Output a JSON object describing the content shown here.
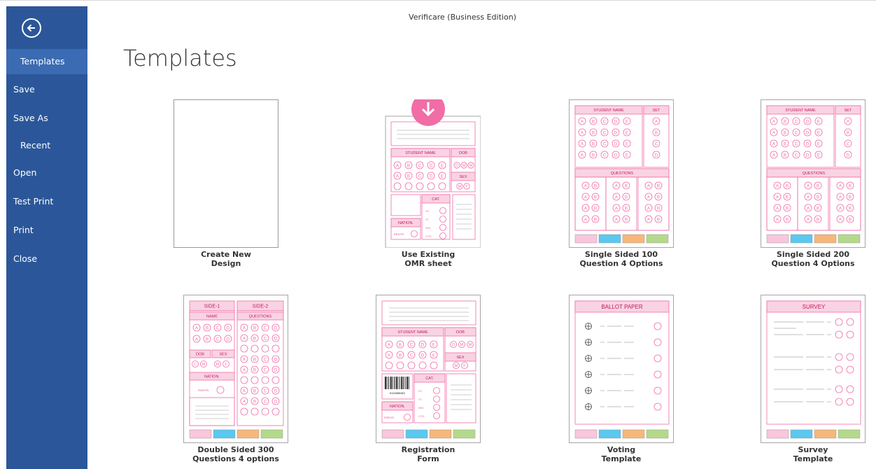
{
  "window": {
    "title": "Verificare (Business Edition)"
  },
  "sidebar": {
    "back_icon": "arrow-left-icon",
    "items": [
      {
        "label": "Templates",
        "active": true
      },
      {
        "label": "Save"
      },
      {
        "label": "Save As"
      },
      {
        "label": "Recent"
      },
      {
        "label": "Open"
      },
      {
        "label": "Test Print"
      },
      {
        "label": "Print"
      },
      {
        "label": "Close"
      }
    ]
  },
  "main": {
    "title": "Templates",
    "templates": [
      {
        "line1": "Create New",
        "line2": "Design"
      },
      {
        "line1": "Use Existing",
        "line2": "OMR sheet"
      },
      {
        "line1": "Single Sided 100",
        "line2": "Question 4 Options"
      },
      {
        "line1": "Single Sided 200",
        "line2": "Question 4 Options"
      },
      {
        "line1": "Double Sided 300",
        "line2": "Questions 4 options"
      },
      {
        "line1": "Registration",
        "line2": "Form"
      },
      {
        "line1": "Voting",
        "line2": "Template"
      },
      {
        "line1": "Survey",
        "line2": "Template"
      }
    ]
  },
  "thumbs": {
    "student_name": "STUDENT NAME",
    "set": "SET",
    "dob": "DOB",
    "sex": "SEX",
    "cat": "CAT.",
    "nation": "NATION.",
    "indian": "INDIAN",
    "questions": "QUESTIONS",
    "side1": "SIDE-1",
    "side2": "SIDE-2",
    "name": "NAME",
    "ballot": "BALLOT PAPER",
    "survey": "SURVEY",
    "barcode_num": "0123456321",
    "cat_opts": [
      "SC",
      "ST",
      "MIN",
      "OTH."
    ],
    "abcde": [
      "A",
      "B",
      "C",
      "D",
      "E"
    ],
    "abcd": [
      "A",
      "B",
      "C",
      "D"
    ],
    "set_opts": [
      "A",
      "B",
      "C",
      "D"
    ],
    "ab": [
      "A",
      "B"
    ],
    "dmm": [
      "D",
      "M",
      "M"
    ],
    "mf": [
      "M",
      "F"
    ]
  },
  "colors": {
    "sidebar": "#2b579a",
    "sidebar_active": "#3b6bb3",
    "pink": "#f06da6",
    "pink_light": "#f9d3e3",
    "swatches": [
      "#f9c6dd",
      "#5bc8f0",
      "#f7b77a",
      "#b5d98a"
    ]
  }
}
